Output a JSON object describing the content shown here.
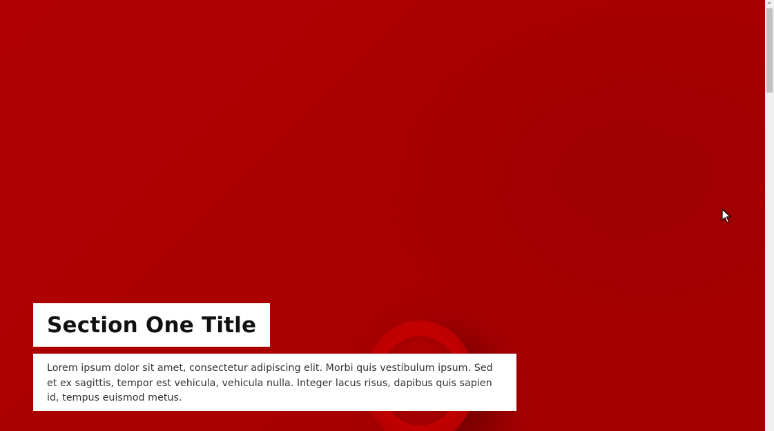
{
  "section": {
    "title": "Section One Title",
    "body": "Lorem ipsum dolor sit amet, consectetur adipiscing elit. Morbi quis vestibulum ipsum. Sed et ex sagittis, tempor est vehicula, vehicula nulla. Integer lacus risus, dapibus quis sapien id, tempus euismod metus."
  },
  "hero": {
    "background_color": "#aa0000",
    "image_subject": "red-cup-on-red-surface"
  },
  "cursor": {
    "icon": "arrow-pointer-icon"
  },
  "scrollbar": {
    "icon": "scroll-up-arrow-icon"
  }
}
